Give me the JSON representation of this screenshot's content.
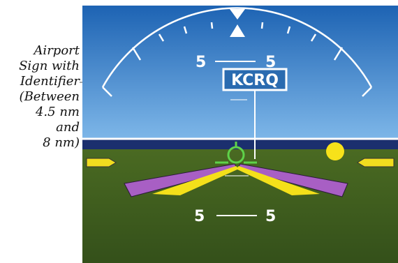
{
  "callout": {
    "lines": [
      "Airport",
      "Sign with",
      "Identifier",
      "(Between",
      "4.5 nm",
      "and",
      "8 nm)"
    ]
  },
  "pfd": {
    "airport_identifier": "KCRQ",
    "pitch_upper_left": "5",
    "pitch_upper_right": "5",
    "pitch_lower_left": "5",
    "pitch_lower_right": "5",
    "colors": {
      "sky_top": "#1d63b3",
      "sky_bottom": "#7db6e8",
      "ground": "#3f5a1e",
      "horizon_band": "#1b2f6e",
      "horizon_line": "#ffffff",
      "runway_outer": "#a85fc4",
      "runway_inner": "#f4e01a",
      "aircraft_symbol": "#5fd24a",
      "sun": "#f7e21a",
      "pitch_marker": "#f1dd1f",
      "sign_border": "#ffffff",
      "sign_fill": "#2a6bb0"
    }
  }
}
